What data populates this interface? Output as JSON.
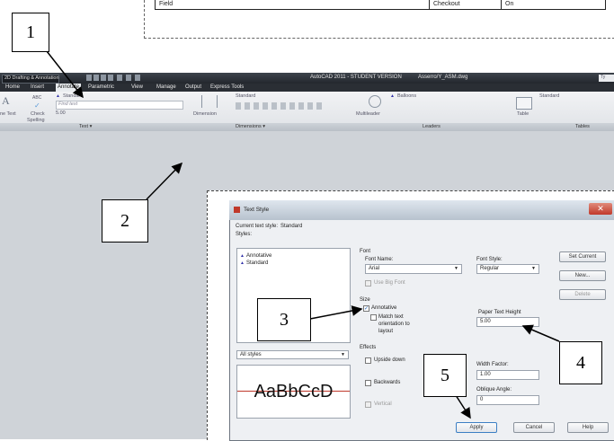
{
  "table_fragment": {
    "col1": "Field",
    "col2": "Checkout",
    "col3": "On"
  },
  "callouts": [
    "1",
    "2",
    "3",
    "4",
    "5"
  ],
  "titlebar": {
    "workspace": "2D Drafting & Annotation",
    "app_title": "AutoCAD 2011 - STUDENT VERSION",
    "file": "Asserro/Y_ASM.dwg",
    "search_placeholder": "Ty"
  },
  "menu": [
    "Home",
    "Insert",
    "Annotate",
    "Parametric",
    "View",
    "Manage",
    "Output",
    "Express Tools"
  ],
  "ribbon": {
    "text_panel": {
      "multiline": "ne Text",
      "abc_label": "ABC",
      "check": "Check",
      "spelling": "Spelling",
      "style": "Standard",
      "find": "Find text",
      "height": "5.00",
      "label": "Text ▾"
    },
    "dimensions_panel": {
      "dimension": "Dimension",
      "style": "Standard",
      "label": "Dimensions ▾"
    },
    "leaders_panel": {
      "multileader": "Multileader",
      "style": "Balloons",
      "label": "Leaders"
    },
    "tables_panel": {
      "table": "Table",
      "style": "Standard",
      "label": "Tables"
    }
  },
  "dialog": {
    "title": "Text Style",
    "current_style_label": "Current text style:",
    "current_style_value": "Standard",
    "styles_label": "Styles:",
    "styles": [
      "Annotative",
      "Standard"
    ],
    "filter": "All styles",
    "preview": "AaBbCcD",
    "font_group": "Font",
    "font_name_label": "Font Name:",
    "font_name": "Arial",
    "font_style_label": "Font Style:",
    "font_style": "Regular",
    "big_font": "Use Big Font",
    "size_group": "Size",
    "annotative": "Annotative",
    "match_orientation": "Match text orientation to layout",
    "paper_height_label": "Paper Text Height",
    "paper_height": "5.00",
    "effects_group": "Effects",
    "upside_down": "Upside down",
    "backwards": "Backwards",
    "vertical": "Vertical",
    "width_factor_label": "Width Factor:",
    "width_factor": "1.00",
    "oblique_label": "Oblique Angle:",
    "oblique": "0",
    "set_current": "Set Current",
    "new": "New...",
    "delete": "Delete",
    "apply": "Apply",
    "cancel": "Cancel",
    "help": "Help"
  }
}
